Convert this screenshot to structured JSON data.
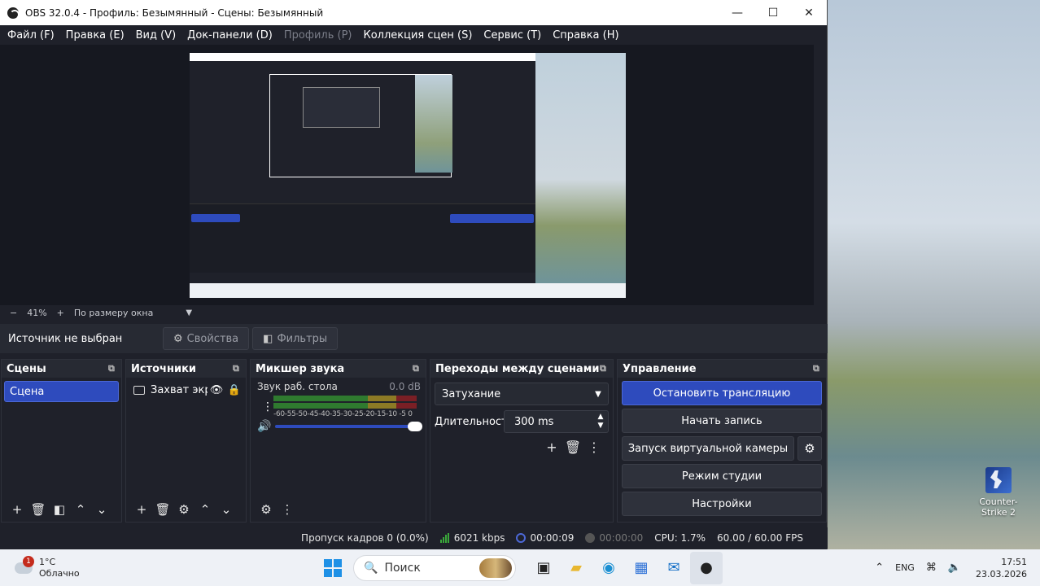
{
  "window": {
    "title": "OBS 32.0.4 - Профиль: Безымянный - Сцены: Безымянный"
  },
  "menu": [
    "Файл (F)",
    "Правка (E)",
    "Вид (V)",
    "Док-панели (D)",
    "Профиль (P)",
    "Коллекция сцен (S)",
    "Сервис (T)",
    "Справка (H)"
  ],
  "zoom": {
    "value": "41%",
    "mode": "По размеру окна"
  },
  "source_bar": {
    "label": "Источник не выбран",
    "properties": "Свойства",
    "filters": "Фильтры"
  },
  "docks": {
    "scenes": {
      "title": "Сцены",
      "items": [
        "Сцена"
      ]
    },
    "sources": {
      "title": "Источники",
      "items": [
        "Захват экр"
      ]
    },
    "mixer": {
      "title": "Микшер звука",
      "track_name": "Звук раб. стола",
      "track_db": "0.0 dB",
      "ticks": "-60-55-50-45-40-35-30-25-20-15-10 -5  0"
    },
    "transitions": {
      "title": "Переходы между сценами",
      "selected": "Затухание",
      "duration_label": "Длительность",
      "duration": "300 ms"
    },
    "controls": {
      "title": "Управление",
      "stop_stream": "Остановить трансляцию",
      "start_record": "Начать запись",
      "virtual_cam": "Запуск виртуальной камеры",
      "studio_mode": "Режим студии",
      "settings": "Настройки"
    }
  },
  "status": {
    "dropped": "Пропуск кадров 0 (0.0%)",
    "bitrate": "6021 kbps",
    "live_time": "00:00:09",
    "rec_time": "00:00:00",
    "cpu": "CPU: 1.7%",
    "fps": "60.00 / 60.00 FPS"
  },
  "desktop": {
    "icon_label": "Counter-Strike 2"
  },
  "taskbar": {
    "temp": "1°C",
    "weather": "Облачно",
    "notif_count": "1",
    "search_placeholder": "Поиск",
    "lang": "ENG",
    "time": "17:51",
    "date": "23.03.2026"
  }
}
